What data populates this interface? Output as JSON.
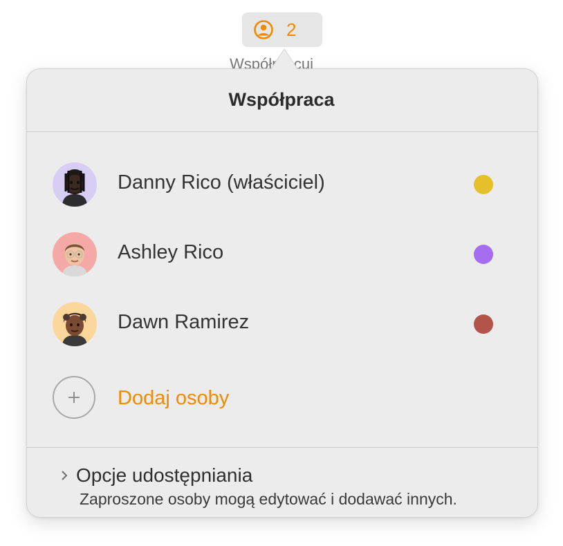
{
  "toolbar": {
    "collaborate_count": "2",
    "collaborate_label": "Współpracuj",
    "accent_color": "#f08a00"
  },
  "popover": {
    "title": "Współpraca",
    "participants": [
      {
        "name": "Danny Rico (właściciel)",
        "color": "#e6c02a",
        "avatar_icon": "memoji-avatar-icon"
      },
      {
        "name": "Ashley Rico",
        "color": "#a56ef0",
        "avatar_icon": "memoji-avatar-icon"
      },
      {
        "name": "Dawn Ramirez",
        "color": "#b3544a",
        "avatar_icon": "memoji-avatar-icon"
      }
    ],
    "add_people_label": "Dodaj osoby",
    "share_options_label": "Opcje udostępniania",
    "share_options_description": "Zaproszone osoby mogą edytować i dodawać innych."
  }
}
